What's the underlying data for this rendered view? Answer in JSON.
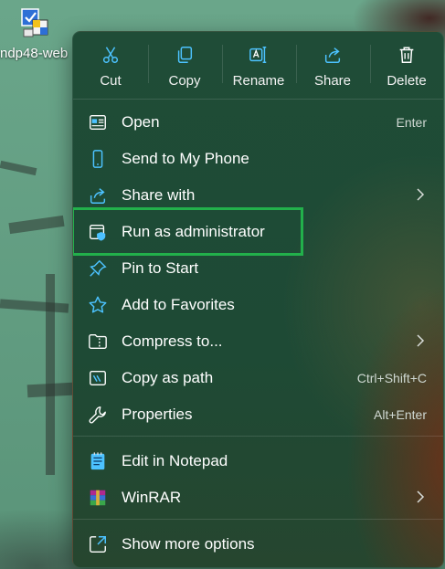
{
  "desktop": {
    "icon_label": "ndp48-web"
  },
  "quick_actions": [
    {
      "label": "Cut",
      "icon": "scissors-icon"
    },
    {
      "label": "Copy",
      "icon": "copy-icon"
    },
    {
      "label": "Rename",
      "icon": "rename-icon"
    },
    {
      "label": "Share",
      "icon": "share-icon"
    },
    {
      "label": "Delete",
      "icon": "trash-icon"
    }
  ],
  "menu_items": [
    {
      "label": "Open",
      "shortcut": "Enter",
      "icon": "open-icon"
    },
    {
      "label": "Send to My Phone",
      "icon": "phone-icon"
    },
    {
      "label": "Share with",
      "icon": "share-with-icon",
      "submenu": true
    },
    {
      "label": "Run as administrator",
      "icon": "shield-icon",
      "highlighted": true
    },
    {
      "label": "Pin to Start",
      "icon": "pin-icon"
    },
    {
      "label": "Add to Favorites",
      "icon": "star-icon"
    },
    {
      "label": "Compress to...",
      "icon": "folder-zip-icon",
      "submenu": true
    },
    {
      "label": "Copy as path",
      "shortcut": "Ctrl+Shift+C",
      "icon": "copy-path-icon"
    },
    {
      "label": "Properties",
      "shortcut": "Alt+Enter",
      "icon": "wrench-icon"
    },
    {
      "label": "Edit in Notepad",
      "icon": "notepad-icon"
    },
    {
      "label": "WinRAR",
      "icon": "winrar-icon",
      "submenu": true
    },
    {
      "label": "Show more options",
      "icon": "more-options-icon"
    }
  ],
  "colors": {
    "highlight_border": "#22b04b",
    "menu_background": "#1f4c37",
    "accent_icon": "#4cc2ff"
  }
}
